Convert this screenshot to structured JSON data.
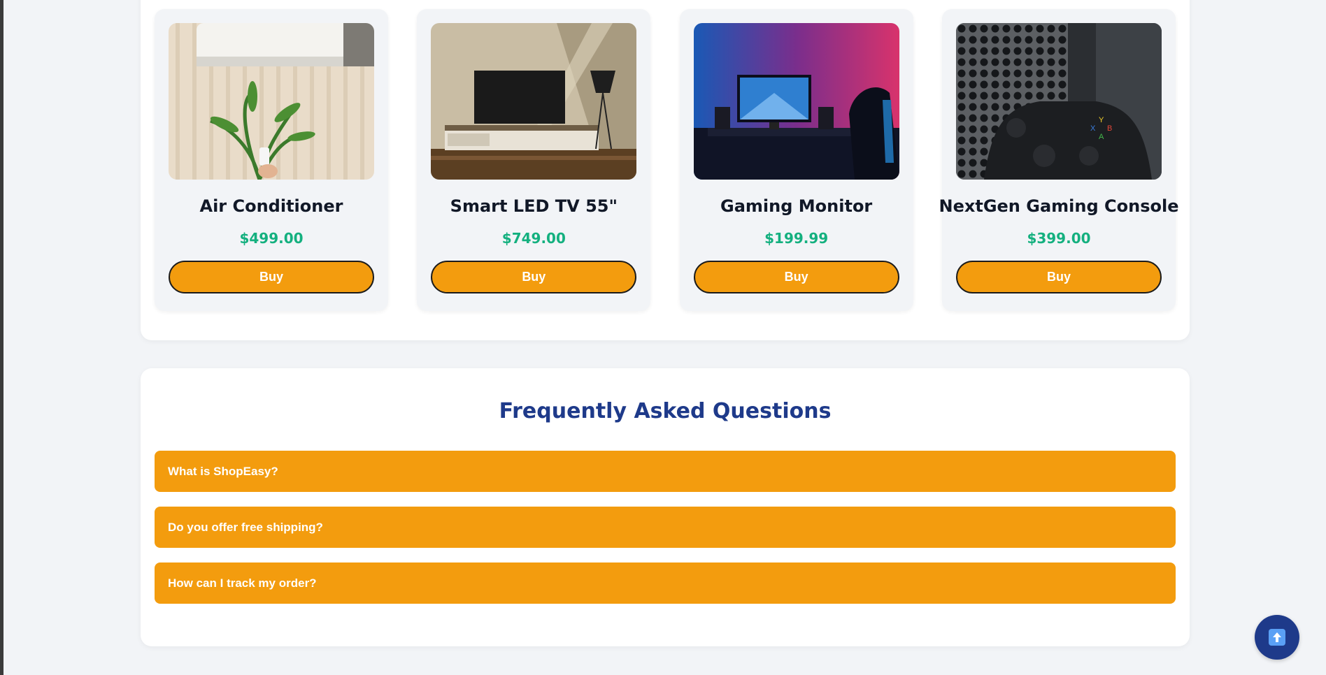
{
  "products": [
    {
      "name": "Air Conditioner",
      "price": "$499.00",
      "buy_label": "Buy",
      "image": "air-conditioner-image"
    },
    {
      "name": "Smart LED TV 55\"",
      "price": "$749.00",
      "buy_label": "Buy",
      "image": "smart-tv-image"
    },
    {
      "name": "Gaming Monitor",
      "price": "$199.99",
      "buy_label": "Buy",
      "image": "gaming-monitor-image"
    },
    {
      "name": "NextGen Gaming Console",
      "price": "$399.00",
      "buy_label": "Buy",
      "image": "gaming-console-image"
    }
  ],
  "faq": {
    "title": "Frequently Asked Questions",
    "items": [
      {
        "question": "What is ShopEasy?"
      },
      {
        "question": "Do you offer free shipping?"
      },
      {
        "question": "How can I track my order?"
      }
    ]
  },
  "scroll_top": {
    "icon": "arrow-up-icon"
  },
  "colors": {
    "accent": "#f39c0e",
    "price": "#14b07f",
    "heading": "#1e3a8a",
    "background": "#f2f4f7"
  }
}
